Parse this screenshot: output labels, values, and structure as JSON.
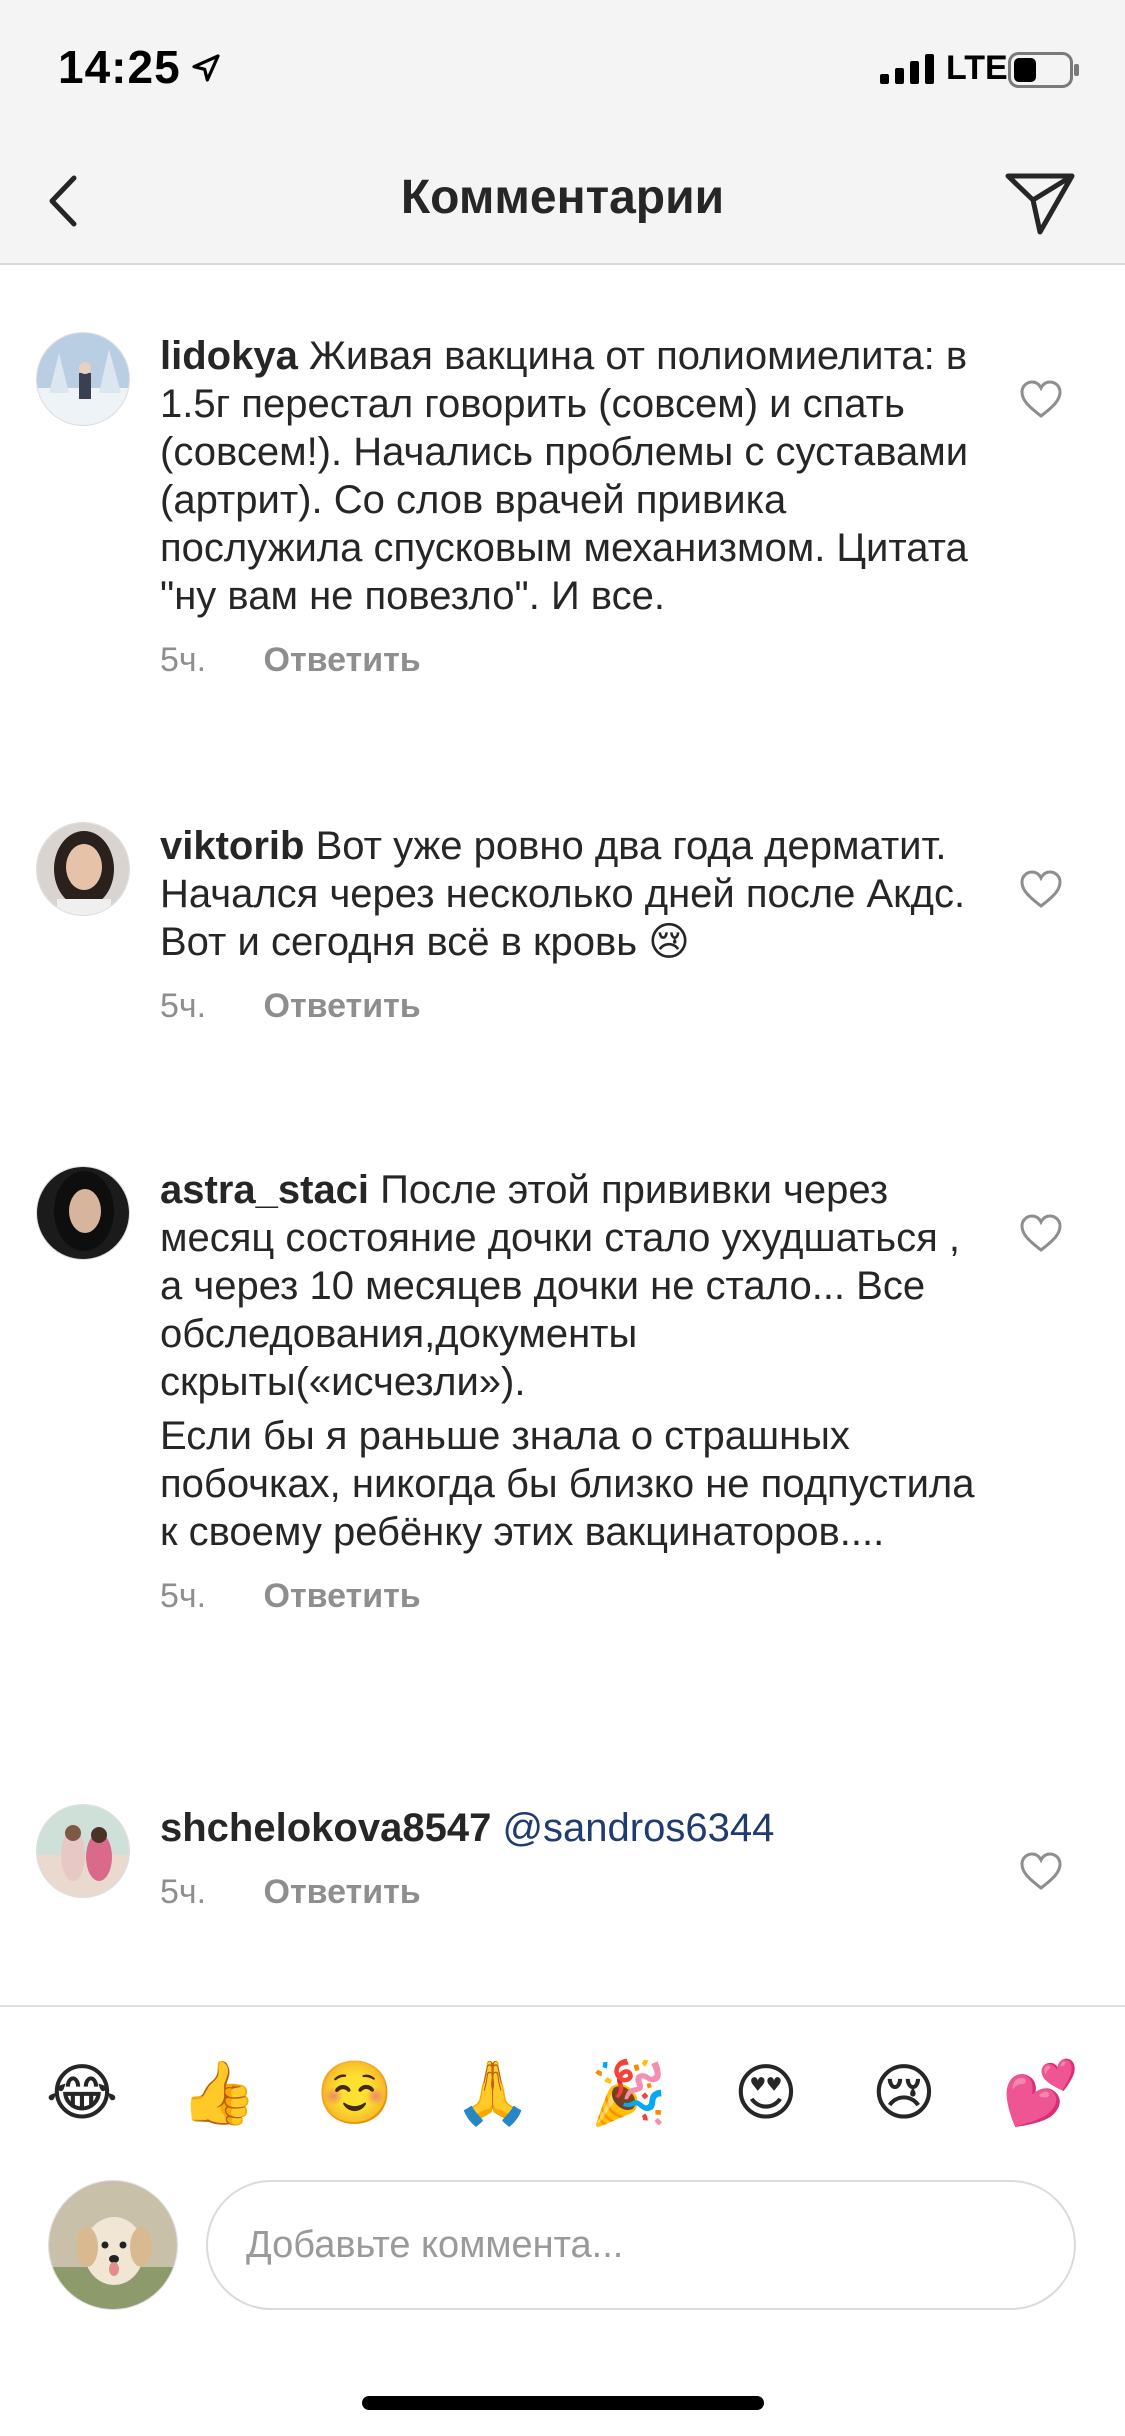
{
  "status_bar": {
    "time": "14:25",
    "network": "LTE"
  },
  "header": {
    "title": "Комментарии"
  },
  "comments": [
    {
      "username": "lidokya",
      "text": "Живая вакцина от полиомиелита: в 1.5г перестал говорить (совсем) и спать (совсем!). Начались проблемы с суставами (артрит). Со слов врачей привика послужила спусковым механизмом. Цитата \"ну вам не повезло\". И все.",
      "time": "5ч.",
      "reply": "Ответить"
    },
    {
      "username": "viktorib",
      "text": "Вот уже ровно два года дерматит. Начался через несколько дней после Акдс. Вот и сегодня всё в кровь 😢",
      "time": "5ч.",
      "reply": "Ответить"
    },
    {
      "username": "astra_staci",
      "text": "После этой прививки через месяц состояние дочки стало ухудшаться , а через 10 месяцев дочки не стало... Все обследования,документы скрыты(«исчезли»).",
      "text2": "Если бы я раньше знала о страшных побочках, никогда бы близко не подпустила  к своему ребёнку этих вакцинаторов....",
      "time": "5ч.",
      "reply": "Ответить"
    },
    {
      "username": "shchelokova8547",
      "mention": "@sandros6344",
      "time": "5ч.",
      "reply": "Ответить"
    }
  ],
  "emoji_bar": [
    "😂",
    "👍",
    "☺️",
    "🙏",
    "🎉",
    "😍",
    "😢",
    "💕"
  ],
  "input": {
    "placeholder": "Добавьте коммента..."
  },
  "colors": {
    "header_bg": "#f4f4f4",
    "text": "#262626",
    "meta": "#8e8e8e",
    "mention": "#1f3b70"
  }
}
